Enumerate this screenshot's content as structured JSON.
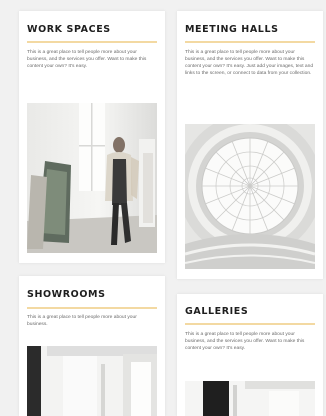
{
  "cards": [
    {
      "title": "WORK SPACES",
      "body": "This is a great place to tell people more about your business, and the services you offer. Want to make this content your own? It's easy.",
      "image": "person-walking-in-loft-photo"
    },
    {
      "title": "MEETING HALLS",
      "body": "This is a great place to tell people more about your business, and the services you offer. Want to make this content your own? It's easy. Just add your images, text and links to the screen, or connect to data from your collection.",
      "image": "spiral-rotunda-skylight-photo"
    },
    {
      "title": "SHOWROOMS",
      "body": "This is a great place to tell people more about your business.",
      "image": "white-interior-photo"
    },
    {
      "title": "GALLERIES",
      "body": "This is a great place to tell people more about your business, and the services you offer. Want to make this content your own? It's easy.",
      "image": "gallery-interior-photo"
    }
  ],
  "colors": {
    "accent_rule": "#f3d9a2",
    "card_background": "#ffffff",
    "page_background": "#f1f1f1",
    "title": "#1e1e1e",
    "body_text": "#6a6a6a"
  }
}
